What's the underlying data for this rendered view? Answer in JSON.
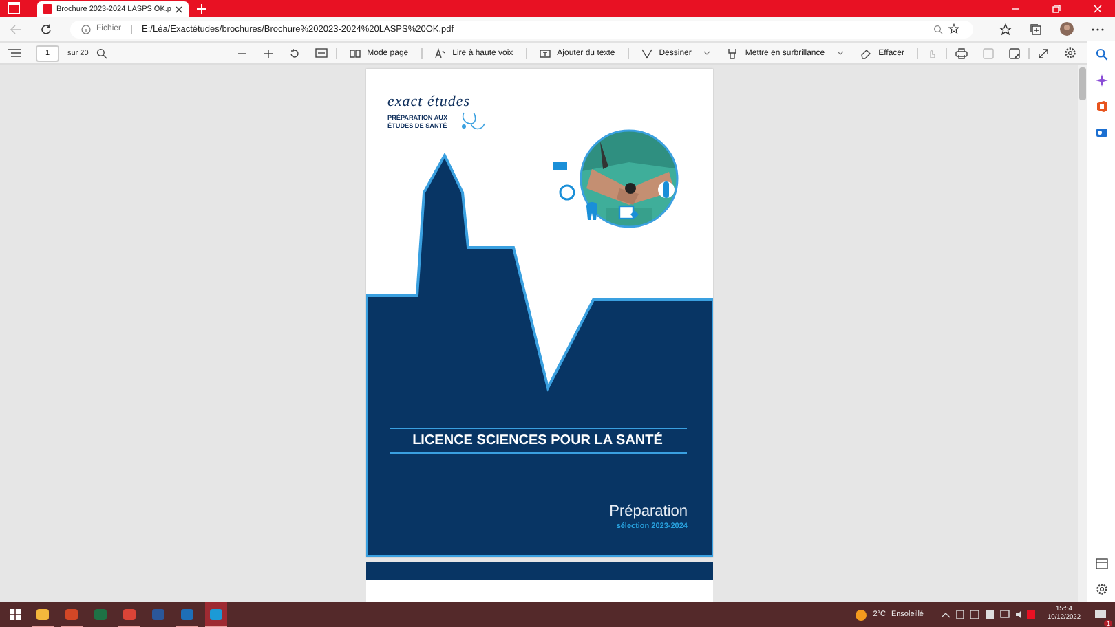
{
  "browser": {
    "tab": {
      "title": "Brochure 2023-2024 LASPS OK.p"
    },
    "address": {
      "label": "Fichier",
      "url": "E:/Léa/Exactétudes/brochures/Brochure%202023-2024%20LASPS%20OK.pdf"
    }
  },
  "pdf_toolbar": {
    "page": "1",
    "page_total": "sur 20",
    "tools": [
      {
        "kind": "mode",
        "label": "Mode page",
        "dropdown": false
      },
      {
        "kind": "read",
        "label": "Lire à haute voix",
        "dropdown": false
      },
      {
        "kind": "text",
        "label": "Ajouter du texte",
        "dropdown": false
      },
      {
        "kind": "draw",
        "label": "Dessiner",
        "dropdown": true
      },
      {
        "kind": "highlight",
        "label": "Mettre en surbrillance",
        "dropdown": true
      },
      {
        "kind": "erase",
        "label": "Effacer",
        "dropdown": false
      }
    ]
  },
  "document": {
    "logo": "exact études",
    "tagline": [
      "PRÉPARATION AUX",
      "ÉTUDES DE SANTÉ"
    ],
    "title": "LICENCE SCIENCES POUR LA SANTÉ",
    "subtitle": "Préparation",
    "edition": "sélection 2023-2024"
  },
  "taskbar": {
    "apps": [
      {
        "kind": "explorer",
        "running": true,
        "selected": false
      },
      {
        "kind": "powerpoint",
        "running": true,
        "selected": false
      },
      {
        "kind": "excel",
        "running": false,
        "selected": false
      },
      {
        "kind": "chrome",
        "running": true,
        "selected": false
      },
      {
        "kind": "word",
        "running": false,
        "selected": false
      },
      {
        "kind": "photos",
        "running": true,
        "selected": false
      },
      {
        "kind": "edge",
        "running": true,
        "selected": true
      }
    ],
    "weather": {
      "temperature": "2°C",
      "condition": "Ensoleillé"
    },
    "time": "15:54",
    "date": "10/12/2022",
    "notification_count": "1"
  }
}
